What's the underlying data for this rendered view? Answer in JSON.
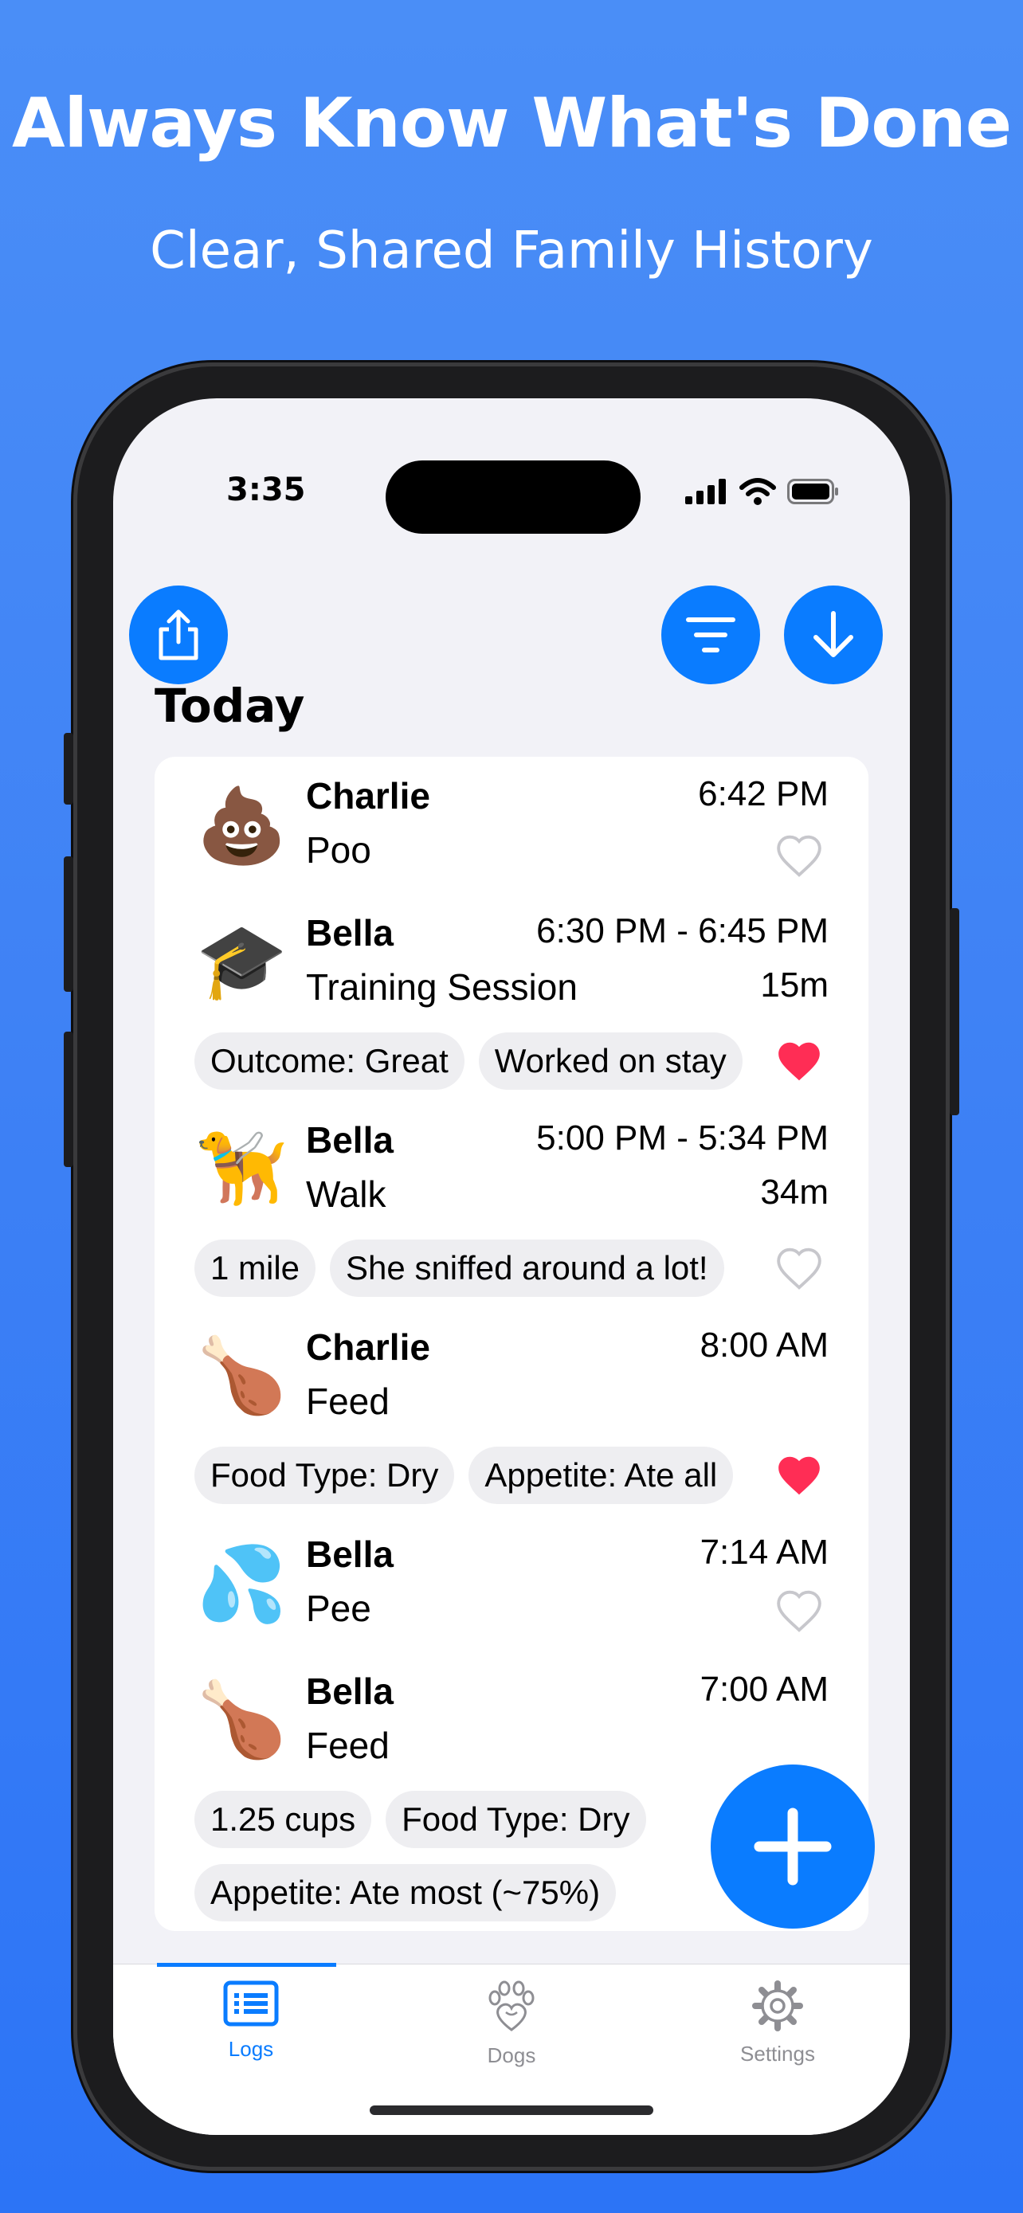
{
  "promo": {
    "headline": "Always Know What's Done",
    "subheadline": "Clear, Shared Family History"
  },
  "status_bar": {
    "time": "3:35"
  },
  "toolbar": {
    "share_icon": "share-icon",
    "filter_icon": "filter-icon",
    "download_icon": "download-icon"
  },
  "section_title": "Today",
  "entries": [
    {
      "emoji": "💩",
      "dog": "Charlie",
      "activity": "Poo",
      "time": "6:42 PM",
      "duration": "",
      "favorited": false,
      "chips": []
    },
    {
      "emoji": "🎓",
      "dog": "Bella",
      "activity": "Training Session",
      "time": "6:30 PM - 6:45 PM",
      "duration": "15m",
      "favorited": true,
      "chips": [
        "Outcome: Great",
        "Worked on stay"
      ]
    },
    {
      "emoji": "🦮",
      "dog": "Bella",
      "activity": "Walk",
      "time": "5:00 PM - 5:34 PM",
      "duration": "34m",
      "favorited": false,
      "chips": [
        "1 mile",
        "She sniffed around a lot!"
      ]
    },
    {
      "emoji": "🍗",
      "dog": "Charlie",
      "activity": "Feed",
      "time": "8:00 AM",
      "duration": "",
      "favorited": true,
      "chips": [
        "Food Type: Dry",
        "Appetite: Ate all"
      ]
    },
    {
      "emoji": "💦",
      "dog": "Bella",
      "activity": "Pee",
      "time": "7:14 AM",
      "duration": "",
      "favorited": false,
      "chips": []
    },
    {
      "emoji": "🍗",
      "dog": "Bella",
      "activity": "Feed",
      "time": "7:00 AM",
      "duration": "",
      "favorited": false,
      "chips": [
        "1.25 cups",
        "Food Type: Dry"
      ],
      "chips_row2": [
        "Appetite: Ate most (~75%)"
      ]
    }
  ],
  "tabs": [
    {
      "label": "Logs",
      "icon": "logs-icon",
      "active": true
    },
    {
      "label": "Dogs",
      "icon": "paw-heart-icon",
      "active": false
    },
    {
      "label": "Settings",
      "icon": "gear-icon",
      "active": false
    }
  ],
  "colors": {
    "accent": "#0a7cff",
    "heart": "#ff2d55",
    "background": "#3f82f5"
  }
}
